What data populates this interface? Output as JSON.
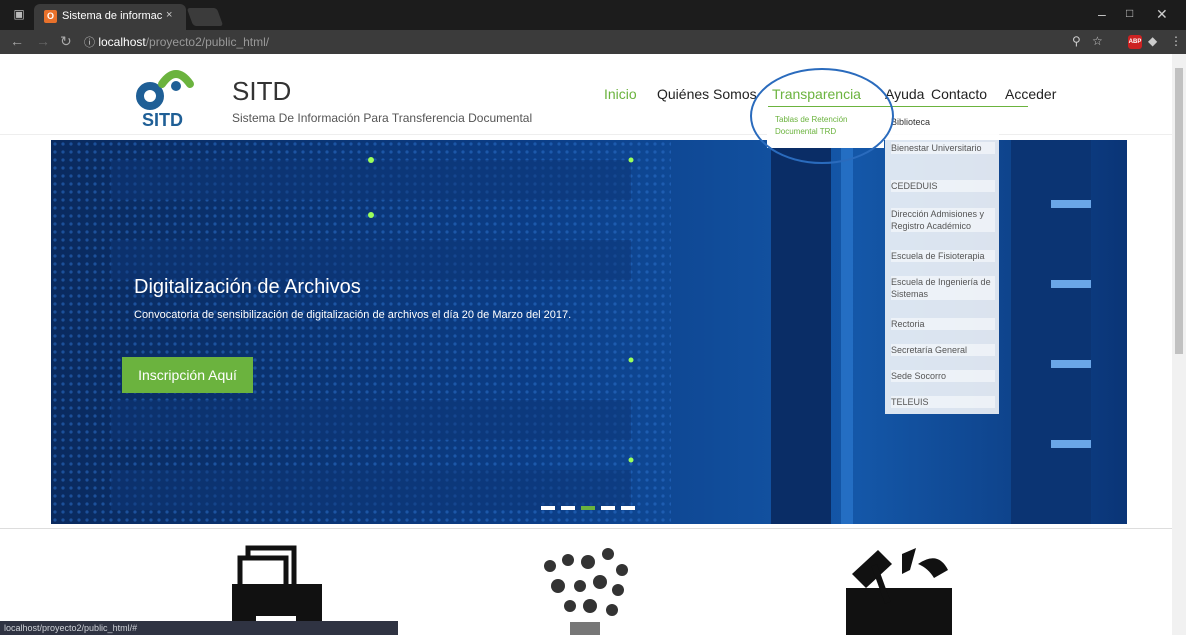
{
  "browser": {
    "tab_title": "Sistema de información",
    "tab_close": "×",
    "url_host": "localhost",
    "url_path": "/proyecto2/public_html/"
  },
  "header": {
    "logo_text": "SITD",
    "brand": "SITD",
    "tagline": "Sistema De Información Para Transferencia Documental"
  },
  "menu": {
    "items": [
      "Inicio",
      "Quiénes Somos",
      "Transparencia",
      "Ayuda",
      "Contacto",
      "Acceder"
    ],
    "active": "Inicio"
  },
  "dropdown": {
    "items": [
      "Tablas de Retención",
      "Documental TRD"
    ]
  },
  "submenu": {
    "items": [
      "Biblioteca",
      "Bienestar Universitario",
      "CEDEDUIS",
      "Dirección Admisiones y Registro Académico",
      "Escuela de Fisioterapia",
      "Escuela de Ingeniería de Sistemas",
      "Rectoria",
      "Secretaría General",
      "Sede Socorro",
      "TELEUIS"
    ]
  },
  "hero": {
    "title": "Digitalización de Archivos",
    "desc": "Convocatoria de sensibilización de digitalización de archivos el día 20 de Marzo del 2017.",
    "button": "Inscripción Aquí"
  },
  "status": {
    "url": "localhost/proyecto2/public_html/#"
  },
  "colors": {
    "accent": "#6bb33e",
    "brand_blue": "#1f5f96",
    "ring": "#2a6bbd"
  },
  "icons": [
    "incognito-icon",
    "favicon-icon",
    "back-icon",
    "forward-icon",
    "reload-icon",
    "info-icon",
    "key-icon",
    "star-icon",
    "adblock-icon",
    "extension-icon",
    "menu-icon",
    "archive-icon",
    "cloud-apps-icon",
    "tools-icon"
  ]
}
